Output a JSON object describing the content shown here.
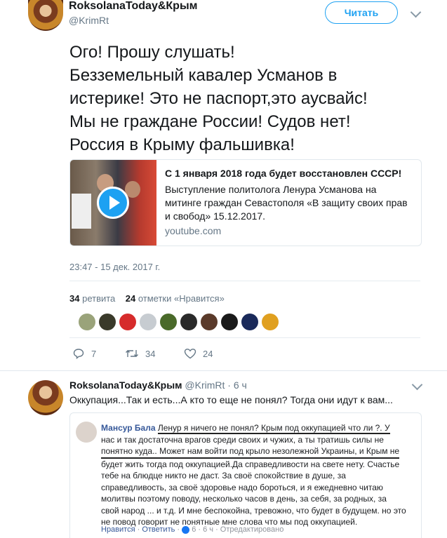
{
  "tweet": {
    "author_name": "RoksolanaToday&Крым",
    "handle": "@KrimRt",
    "follow_label": "Читать",
    "text_lines": [
      "Ого! Прошу слушать!",
      "Безземельный кавалер Усманов в",
      "истерике! Это не паспорт,это аусвайс!",
      "Мы не граждане России! Судов нет!",
      "Россия в Крыму фальшивка!"
    ],
    "card": {
      "title": "С 1 января 2018 года будет восстановлен СССР!",
      "description": "Выступление политолога Ленура Усманова на митинге граждан Севастополя «В защиту своих прав и свобод» 15.12.2017.",
      "domain": "youtube.com"
    },
    "timestamp": "23:47 - 15 дек. 2017 г.",
    "retweets_count": "34",
    "retweets_label": "ретвита",
    "likes_count": "24",
    "likes_label": "отметки «Нравится»",
    "actions": {
      "reply": "7",
      "retweet": "34",
      "like": "24"
    },
    "liker_colors": [
      "#9aa37a",
      "#3a3a2a",
      "#d62b2b",
      "#c7ccd1",
      "#4a6a2a",
      "#2a2a2a",
      "#5a3a2a",
      "#1a1a1a",
      "#1a2a5a",
      "#e0a020"
    ]
  },
  "reply": {
    "author_name": "RoksolanaToday&Крым",
    "handle": "@KrimRt",
    "time": "· 6 ч",
    "text": "Оккупация...Так и есть...А кто то еще не понял? Тогда они идут к вам...",
    "fb_comment": {
      "name": "Мансур Бала",
      "lines": [
        "Ленур я ничего не понял? Крым под оккупацией что ли ?. У",
        "нас и так достаточна врагов среди своих и чужих, а ты тратишь силы не",
        "понятно куда.. Может нам войти под крыло незолежной Украины, и Крым не",
        "будет жить тогда под оккупацией.Да справедливости на свете нету. Счастье",
        "тебе на блюдце никто не даст. За своё спокойствие в душе, за",
        "справедливость, за своё здоровье надо бороться, и я ежедневно читаю",
        "молитвы поэтому поводу, несколько часов в день, за себя, за родных, за",
        "свой народ ... и т.д. И мне беспокойна, тревожно, что будет в будущем. но это",
        "не повод говорит не понятные мне слова что мы под оккупацией."
      ],
      "like_label": "Нравится",
      "reply_label": "Ответить",
      "reactions": "6",
      "time": "6 ч",
      "edited": "Отредактировано"
    }
  }
}
